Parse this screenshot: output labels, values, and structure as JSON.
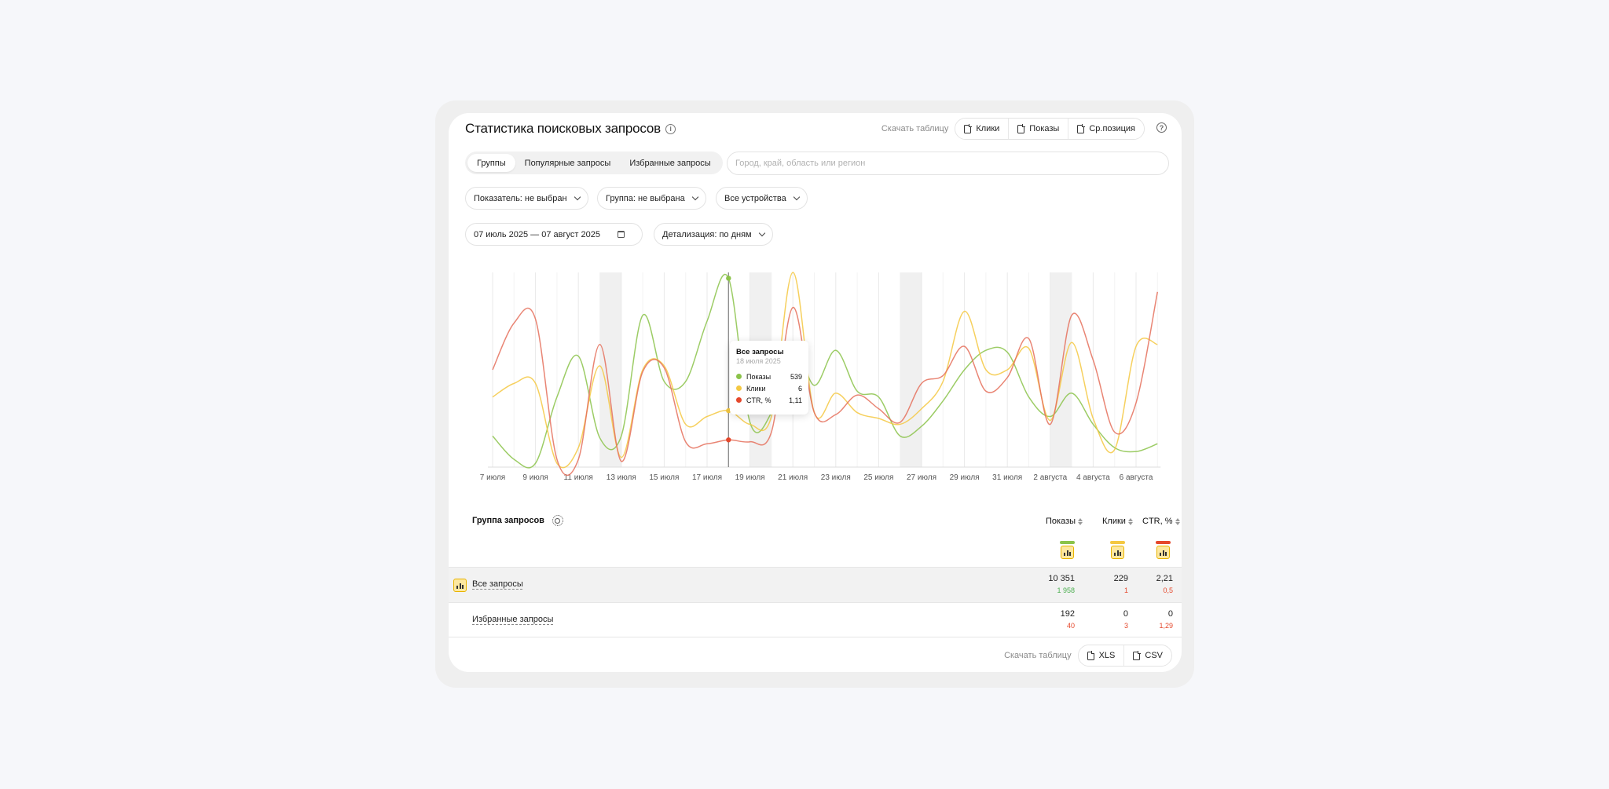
{
  "header": {
    "title": "Статистика поисковых запросов",
    "download_label": "Скачать таблицу",
    "download_buttons": [
      "Клики",
      "Показы",
      "Ср.позиция"
    ]
  },
  "tabs": [
    "Группы",
    "Популярные запросы",
    "Избранные запросы"
  ],
  "search": {
    "placeholder": "Город, край, область или регион"
  },
  "filters": {
    "metric": "Показатель: не выбран",
    "group": "Группа: не выбрана",
    "devices": "Все устройства",
    "date_range": "07 июль 2025 — 07 август 2025",
    "detail": "Детализация: по дням"
  },
  "chart_data": {
    "type": "line",
    "x": [
      "7 июля",
      "8 июля",
      "9 июля",
      "10 июля",
      "11 июля",
      "12 июля",
      "13 июля",
      "14 июля",
      "15 июля",
      "16 июля",
      "17 июля",
      "18 июля",
      "19 июля",
      "20 июля",
      "21 июля",
      "22 июля",
      "23 июля",
      "24 июля",
      "25 июля",
      "26 июля",
      "27 июля",
      "28 июля",
      "29 июля",
      "30 июля",
      "31 июля",
      "1 августа",
      "2 августа",
      "3 августа",
      "4 августа",
      "5 августа",
      "6 августа",
      "7 августа"
    ],
    "x_tick_labels": [
      "7 июля",
      "9 июля",
      "11 июля",
      "13 июля",
      "15 июля",
      "17 июля",
      "19 июля",
      "21 июля",
      "23 июля",
      "25 июля",
      "27 июля",
      "29 июля",
      "31 июля",
      "2 августа",
      "4 августа",
      "6 августа"
    ],
    "shaded_ranges": [
      [
        "12 июля",
        "13 июля"
      ],
      [
        "19 июля",
        "20 июля"
      ],
      [
        "26 июля",
        "27 июля"
      ],
      [
        "2 августа",
        "3 августа"
      ]
    ],
    "series": [
      {
        "name": "Показы",
        "color": "#8bc34a",
        "values": [
          0.16,
          0.04,
          0.02,
          0.36,
          0.57,
          0.15,
          0.16,
          0.78,
          0.44,
          0.44,
          0.75,
          0.97,
          0.23,
          0.28,
          0.63,
          0.42,
          0.6,
          0.39,
          0.36,
          0.16,
          0.21,
          0.34,
          0.5,
          0.6,
          0.59,
          0.36,
          0.26,
          0.38,
          0.22,
          0.1,
          0.08,
          0.12
        ]
      },
      {
        "name": "Клики",
        "color": "#f4c842",
        "values": [
          0.36,
          0.43,
          0.43,
          0.02,
          0.1,
          0.52,
          0.05,
          0.5,
          0.52,
          0.22,
          0.26,
          0.29,
          0.22,
          0.26,
          1.0,
          0.28,
          0.38,
          0.28,
          0.25,
          0.22,
          0.3,
          0.44,
          0.8,
          0.5,
          0.5,
          0.61,
          0.24,
          0.64,
          0.25,
          0.09,
          0.62,
          0.63
        ]
      },
      {
        "name": "CTR, %",
        "color": "#e5705c",
        "values": [
          0.5,
          0.74,
          0.76,
          0.04,
          0.04,
          0.63,
          0.03,
          0.49,
          0.51,
          0.13,
          0.12,
          0.14,
          0.13,
          0.18,
          0.82,
          0.28,
          0.27,
          0.37,
          0.3,
          0.23,
          0.43,
          0.47,
          0.62,
          0.39,
          0.46,
          0.66,
          0.22,
          0.78,
          0.55,
          0.18,
          0.33,
          0.9
        ]
      }
    ],
    "hover_index": 11,
    "tooltip": {
      "title": "Все запросы",
      "date": "18 июля 2025",
      "rows": [
        {
          "name": "Показы",
          "value": "539",
          "color": "#8bc34a"
        },
        {
          "name": "Клики",
          "value": "6",
          "color": "#f4c842"
        },
        {
          "name": "CTR, %",
          "value": "1,11",
          "color": "#e5482c"
        }
      ]
    }
  },
  "table": {
    "group_header": "Группа запросов",
    "columns": [
      {
        "label": "Показы",
        "color": "#8bc34a"
      },
      {
        "label": "Клики",
        "color": "#f4c842"
      },
      {
        "label": "CTR, %",
        "color": "#e5482c"
      }
    ],
    "rows": [
      {
        "label": "Все запросы",
        "values": [
          "10 351",
          "229",
          "2,21"
        ],
        "sub": [
          "1 958",
          "1",
          "0,5"
        ],
        "sub_colors": [
          "green",
          "red",
          "red"
        ]
      },
      {
        "label": "Избранные запросы",
        "values": [
          "192",
          "0",
          "0"
        ],
        "sub": [
          "40",
          "3",
          "1,29"
        ],
        "sub_colors": [
          "red",
          "red",
          "red"
        ]
      }
    ],
    "download_label": "Скачать таблицу",
    "download_buttons": [
      "XLS",
      "CSV"
    ]
  }
}
